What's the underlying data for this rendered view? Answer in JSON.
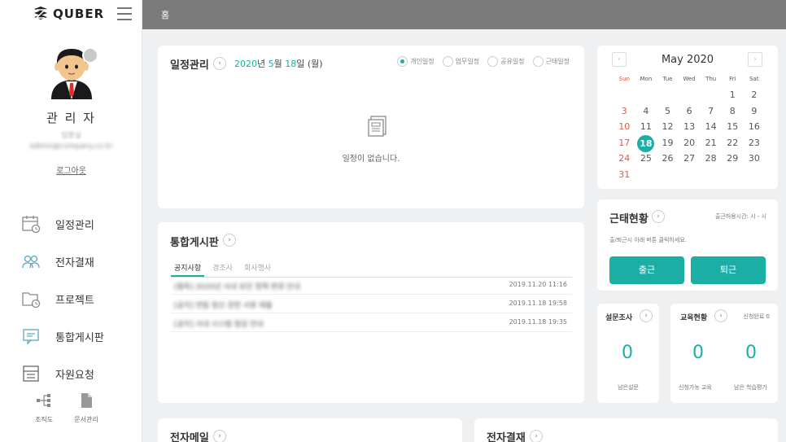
{
  "brand": {
    "name": "QUBER"
  },
  "header": {
    "breadcrumb": "홈"
  },
  "profile": {
    "name": "관 리 자",
    "dept": "임원실",
    "email": "admin@company.co.kr",
    "logout": "로그아웃"
  },
  "nav": [
    {
      "label": "일정관리",
      "icon": "calendar-icon"
    },
    {
      "label": "전자결재",
      "icon": "users-icon"
    },
    {
      "label": "프로젝트",
      "icon": "project-icon"
    },
    {
      "label": "통합게시판",
      "icon": "board-icon"
    },
    {
      "label": "자원요청",
      "icon": "resource-icon"
    }
  ],
  "subnav": [
    {
      "label": "조직도",
      "icon": "org-chart-icon"
    },
    {
      "label": "문서관리",
      "icon": "document-icon"
    }
  ],
  "schedule": {
    "title": "일정관리",
    "date_year": "2020",
    "date_mid1": "년 ",
    "date_month": "5",
    "date_mid2": "월 ",
    "date_day": "18",
    "date_tail": "일 (월)",
    "filters": [
      "개인일정",
      "업무일정",
      "공유일정",
      "근태일정"
    ],
    "empty": "일정이 없습니다."
  },
  "board": {
    "title": "통합게시판",
    "tabs": [
      "공지사항",
      "경조사",
      "회사행사"
    ],
    "posts": [
      {
        "title": "[필독] 2020년 사내 보안 정책 변경 안내",
        "date": "2019.11.20 11:16"
      },
      {
        "title": "[공지] 연말 정산 관련 서류 제출",
        "date": "2019.11.18 19:58"
      },
      {
        "title": "[공지] 사내 시스템 점검 안내",
        "date": "2019.11.18 19:35"
      }
    ]
  },
  "calendar": {
    "month": "May 2020",
    "dow": [
      "Sun",
      "Mon",
      "Tue",
      "Wed",
      "Thu",
      "Fri",
      "Sat"
    ],
    "leading_blanks": 5,
    "days": 31,
    "today": 18
  },
  "attendance": {
    "title": "근태현황",
    "hours": "출근허용시간: 시 - 시",
    "hint": "출/퇴근시 아래 버튼 클릭하세요.",
    "checkin": "출근",
    "checkout": "퇴근"
  },
  "survey": {
    "title": "설문조사",
    "count": "0",
    "label": "남은설문"
  },
  "education": {
    "title": "교육현황",
    "status": "신청완료 0",
    "available_count": "0",
    "available_label": "신청가능 교육",
    "remaining_count": "0",
    "remaining_label": "남은 학습평가"
  },
  "mail": {
    "title": "전자메일"
  },
  "approval": {
    "title": "전자결재"
  },
  "colors": {
    "accent": "#1aaea5",
    "topbar": "#7b7b7b",
    "sunday": "#e05a4a"
  }
}
